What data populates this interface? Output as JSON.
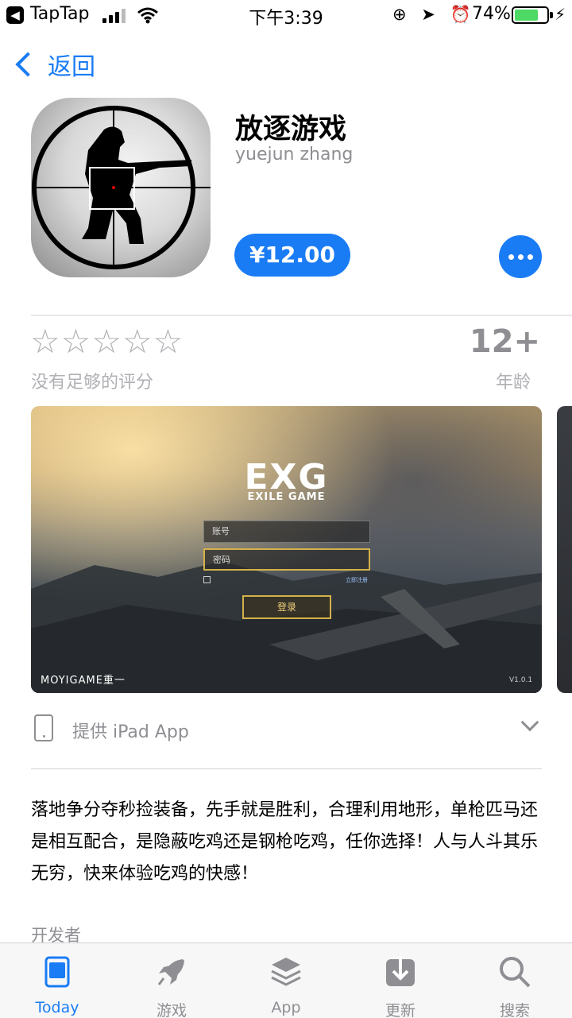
{
  "status_bar": {
    "back_glyph": "◀",
    "app_name": "TapTap",
    "time": "下午3:39",
    "icons": "⊕ ➤ ⏰",
    "battery": "74%",
    "battery_level": 0.74,
    "battery_color": "#4cd964"
  },
  "nav": {
    "back_label": "返回"
  },
  "app": {
    "title": "放逐游戏",
    "developer": "yuejun zhang",
    "price": "¥12.00",
    "accent_color": "#1a7cf5"
  },
  "ratings": {
    "stars": "☆☆☆☆☆",
    "note": "没有足够的评分",
    "age_value": "12+",
    "age_label": "年龄"
  },
  "screenshot": {
    "logo": "EXG",
    "subtitle": "EXILE GAME",
    "account_placeholder": "账号",
    "password_placeholder": "密码",
    "register_link": "立即注册",
    "login_button": "登录",
    "brand": "MOYIGAME重一",
    "version": "V1.0.1"
  },
  "ipad_row": {
    "label": "提供 iPad App"
  },
  "description": "落地争分夺秒捡装备，先手就是胜利，合理利用地形，单枪匹马还是相互配合，是隐蔽吃鸡还是钢枪吃鸡，任你选择！人与人斗其乐无穷，快来体验吃鸡的快感！",
  "developer_section": {
    "label": "开发者"
  },
  "tabbar": {
    "tabs": [
      {
        "label": "Today",
        "icon": "today-icon",
        "active": true
      },
      {
        "label": "游戏",
        "icon": "rocket-icon",
        "active": false
      },
      {
        "label": "App",
        "icon": "layers-icon",
        "active": false
      },
      {
        "label": "更新",
        "icon": "download-icon",
        "active": false
      },
      {
        "label": "搜索",
        "icon": "search-icon",
        "active": false
      }
    ]
  }
}
